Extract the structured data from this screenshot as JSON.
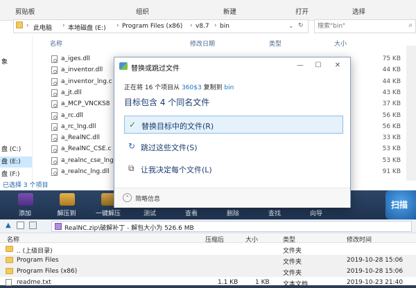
{
  "explorer": {
    "ribbon_tabs": [
      "剪贴板",
      "组织",
      "新建",
      "打开",
      "选择"
    ],
    "address": [
      "此电脑",
      "本地磁盘 (E:)",
      "Program Files (x86)",
      "v8.7",
      "bin"
    ],
    "search_placeholder": "搜索\"bin\"",
    "columns": {
      "name": "名称",
      "date": "修改日期",
      "type": "类型",
      "size": "大小"
    },
    "nav_items": [
      "象",
      "盘 (C:)",
      "盘 (E:)",
      "盘 (F:)"
    ],
    "files": [
      {
        "name": "a_iges.dll",
        "size": "75 KB"
      },
      {
        "name": "a_inventor.dll",
        "size": "44 KB"
      },
      {
        "name": "a_inventor_lng.c",
        "size": "44 KB"
      },
      {
        "name": "a_jt.dll",
        "size": "43 KB"
      },
      {
        "name": "a_MCP_VNCKS8",
        "size": "37 KB"
      },
      {
        "name": "a_rc.dll",
        "size": "56 KB"
      },
      {
        "name": "a_rc_lng.dll",
        "size": "56 KB"
      },
      {
        "name": "a_RealNC.dll",
        "size": "33 KB"
      },
      {
        "name": "a_RealNC_CSE.c",
        "size": "53 KB"
      },
      {
        "name": "a_realnc_cse_lng",
        "size": "53 KB"
      },
      {
        "name": "a_realnc_lng.dll",
        "size": "91 KB"
      }
    ],
    "status": "已选择 3 个项目"
  },
  "dialog": {
    "title": "替换或跳过文件",
    "line_prefix": "正在将 16 个项目从",
    "source": "360$3",
    "line_mid": "复制到",
    "dest": "bin",
    "heading": "目标包含 4 个同名文件",
    "options": [
      {
        "label": "替换目标中的文件(R)",
        "icon": "✓"
      },
      {
        "label": "跳过这些文件(S)",
        "icon": "↻"
      },
      {
        "label": "让我决定每个文件(L)",
        "icon": "⧉"
      }
    ],
    "details": "简略信息",
    "controls": {
      "minimize": "—",
      "maximize": "☐",
      "close": "✕"
    }
  },
  "winrar": {
    "tools": [
      "添加",
      "解压到",
      "一键解压",
      "测试",
      "查看",
      "删除",
      "查找",
      "向导"
    ],
    "scan": "扫描",
    "path": "RealNC.zip\\破解补丁 - 解包大小为 526.6 MB",
    "columns": {
      "name": "名称",
      "packed": "压缩后",
      "size": "大小",
      "type": "类型",
      "modified": "修改时间"
    },
    "rows": [
      {
        "name": ".. (上级目录)",
        "packed": "",
        "size": "",
        "type": "文件夹",
        "modified": ""
      },
      {
        "name": "Program Files",
        "packed": "",
        "size": "",
        "type": "文件夹",
        "modified": "2019-10-28 15:06"
      },
      {
        "name": "Program Files (x86)",
        "packed": "",
        "size": "",
        "type": "文件夹",
        "modified": "2019-10-28 15:06"
      },
      {
        "name": "readme.txt",
        "packed": "1.1 KB",
        "size": "1 KB",
        "type": "文本文档",
        "modified": "2019-10-23 21:40"
      }
    ]
  },
  "colors": {
    "accent": "#1a6fc4",
    "selection": "#e5f1fb",
    "toolbar": "#2d4566"
  }
}
